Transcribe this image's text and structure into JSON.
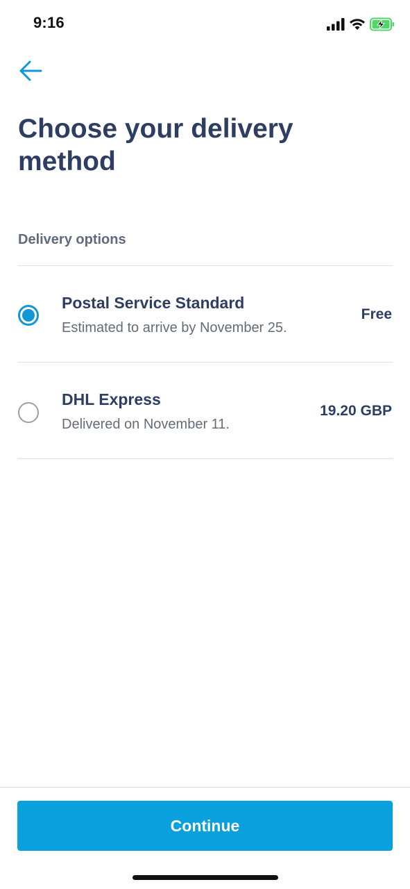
{
  "status_bar": {
    "time": "9:16",
    "icons": [
      "signal-icon",
      "wifi-icon",
      "battery-charging-icon"
    ],
    "battery_color": "#4cd964"
  },
  "header": {
    "back_icon": "arrow-left-icon",
    "title": "Choose your delivery method"
  },
  "delivery": {
    "section_label": "Delivery options",
    "options": [
      {
        "name": "Postal Service Standard",
        "description": "Estimated to arrive by November 25.",
        "price": "Free",
        "selected": true
      },
      {
        "name": "DHL Express",
        "description": "Delivered on November 11.",
        "price": "19.20 GBP",
        "selected": false
      }
    ]
  },
  "footer": {
    "continue_label": "Continue"
  },
  "colors": {
    "accent": "#0aa0dd",
    "heading": "#2e3e63",
    "muted_text": "#646c78",
    "divider": "#dcdfe4"
  }
}
